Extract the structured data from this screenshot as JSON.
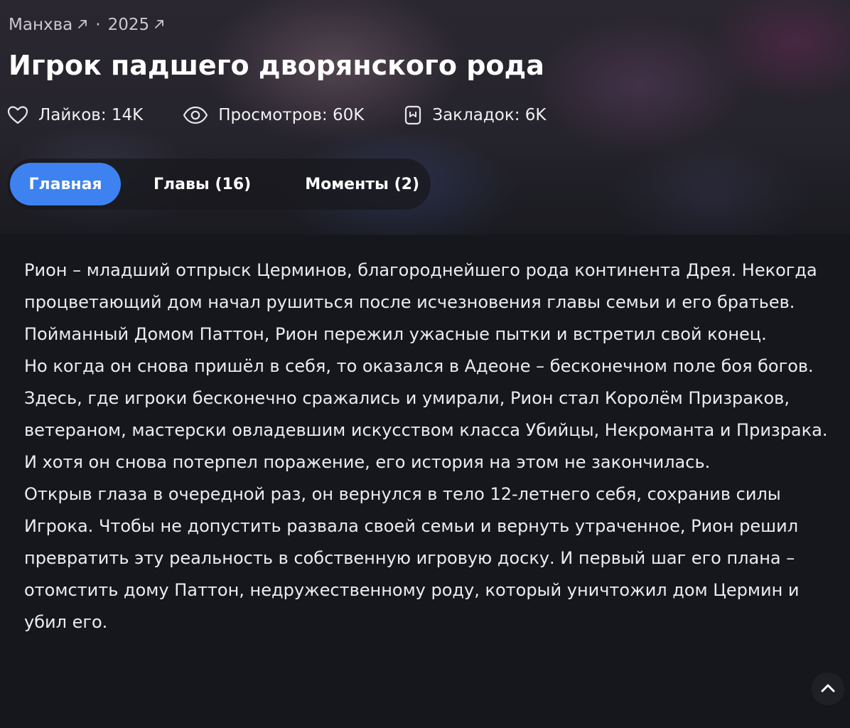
{
  "meta": {
    "type_label": "Манхва",
    "year_label": "2025",
    "separator": "·"
  },
  "title": "Игрок падшего дворянского рода",
  "stats": {
    "likes": "Лайков: 14K",
    "views": "Просмотров: 60K",
    "bookmarks": "Закладок: 6K"
  },
  "tabs": [
    {
      "label": "Главная",
      "active": true
    },
    {
      "label": "Главы (16)",
      "active": false
    },
    {
      "label": "Моменты (2)",
      "active": false
    }
  ],
  "description": [
    "Рион – младший отпрыск Церминов, благороднейшего рода континента Дрея. Некогда процветающий дом начал рушиться после исчезновения главы семьи и его братьев. Пойманный Домом Паттон, Рион пережил ужасные пытки и встретил свой конец.",
    "Но когда он снова пришёл в себя, то оказался в Адеоне – бесконечном поле боя богов. Здесь, где игроки бесконечно сражались и умирали, Рион стал Королём Призраков, ветераном, мастерски овладевшим искусством класса Убийцы, Некроманта и Призрака. И хотя он снова потерпел поражение, его история на этом не закончилась.",
    "Открыв глаза в очередной раз, он вернулся в тело 12-летнего себя, сохранив силы Игрока. Чтобы не допустить развала своей семьи и вернуть утраченное, Рион решил превратить эту реальность в собственную игровую доску. И первый шаг его плана – отомстить дому Паттон, недружественному роду, который уничтожил дом Цермин и убил его."
  ],
  "icons": {
    "external_link": "arrow-up-right-icon",
    "likes": "heart-icon",
    "views": "eye-icon",
    "bookmarks": "bookmark-icon",
    "scroll_top": "chevron-up-icon"
  },
  "colors": {
    "accent": "#3d82f0",
    "background": "#16171c",
    "text": "#ffffff",
    "muted": "#c9c9cf"
  }
}
